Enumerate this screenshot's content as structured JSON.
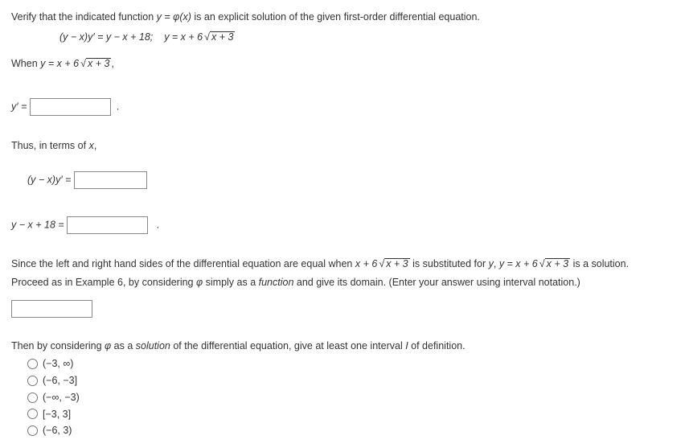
{
  "intro": "Verify that the indicated function ",
  "intro_mid": " is an explicit solution of the given first-order differential equation.",
  "eq_lhs": "(y − x)y′ = y − x + 18;",
  "eq_rhs_prefix": "y = x + 6",
  "eq_rhs_under": "x + 3",
  "when_prefix": "When ",
  "when_y": "y = x + 6",
  "when_under": "x + 3",
  "when_suffix": ",",
  "yprime_label": "y′ =",
  "thus_text": "Thus, in terms of ",
  "thus_var": "x",
  "thus_comma": ",",
  "line_a_lhs": "(y − x)y′  =",
  "line_b_lhs": "y − x + 18  =",
  "since_a": "Since the left and right hand sides of the differential equation are equal when ",
  "since_b": "x + 6",
  "since_under": "x + 3",
  "since_c": " is substituted for ",
  "since_y": "y",
  "since_d": ", ",
  "since_e": "y = x + 6",
  "since_f_under": "x + 3",
  "since_g": " is a solution.",
  "proceed_a": "Proceed as in Example 6, by considering ",
  "phi": "φ",
  "proceed_b": " simply as a ",
  "function_word": "function",
  "proceed_c": " and give its domain. (Enter your answer using interval notation.)",
  "then_a": "Then by considering ",
  "then_b": " as a ",
  "solution_word": "solution",
  "then_c": " of the differential equation, give at least one interval ",
  "then_I": "I",
  "then_d": " of definition.",
  "options": {
    "o1": "(−3, ∞)",
    "o2": "(−6, −3]",
    "o3": "(−∞, −3)",
    "o4": "[−3, 3]",
    "o5": "(−6, 3)"
  },
  "y_eq_phi": "y = φ(x)"
}
